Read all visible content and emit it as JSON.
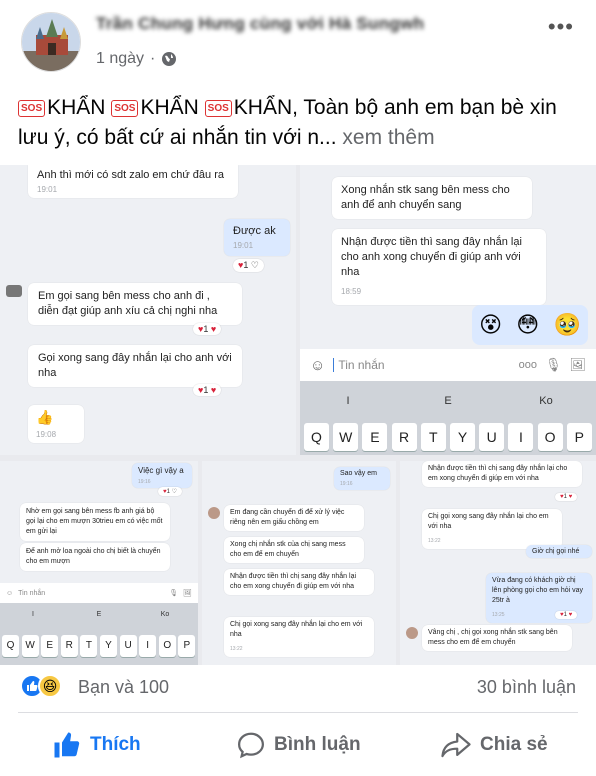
{
  "post": {
    "author": "Trần Chung Hưng cùng với Hà Sungwh",
    "time": "1 ngày",
    "sos_badge": "SOS",
    "text_main": "KHẨN  KHẨN  KHẨN, Toàn bộ anh em bạn bè xin lưu ý, có bất cứ ai nhắn tin với n...",
    "seg1": "KHẨN",
    "seg2": "KHẨN",
    "seg3": "KHẨN, Toàn bộ anh em bạn bè xin lưu ý, có bất cứ ai nhắn tin với n...",
    "see_more": "xem thêm"
  },
  "shot1": {
    "m1": "Anh thì mới có sdt zalo em chứ đâu ra",
    "m1_time": "19:01",
    "m2": "Được ak",
    "m2_time": "19:01",
    "m2_react": "1",
    "m3": "Em gọi sang bên mess cho anh đi , diễn đạt giúp anh xíu cả chị nghi nha",
    "m3_react": "1",
    "m4": "Gọi xong sang đây nhắn lại cho anh với nha",
    "m4_react": "1",
    "m5_time": "19:08"
  },
  "shot2": {
    "m1": "Xong nhắn stk sang bên mess cho anh để anh chuyển sang",
    "m2": "Nhận được tiền thì sang đây nhắn lại cho anh xong chuyển đi giúp anh với nha",
    "m2_time": "18:59",
    "input_placeholder": "Tin nhắn",
    "suggest": [
      "I",
      "E",
      "Ko"
    ],
    "keys": [
      "Q",
      "W",
      "E",
      "R",
      "T",
      "Y",
      "U",
      "I",
      "O",
      "P"
    ]
  },
  "shot3": {
    "m1": "Việc gì vậy a",
    "m1_time": "19:16",
    "m2": "Nhờ em gọi sang bên mess fb anh giá bộ gọi lại cho em mượn 30trieu em có việc mốt em gửi lại",
    "m3": "Để anh mở loa ngoài cho chị biết là chuyển cho em mượn",
    "input_placeholder": "Tin nhắn",
    "suggest": [
      "I",
      "E",
      "Ko"
    ],
    "keys": [
      "Q",
      "W",
      "E",
      "R",
      "T",
      "Y",
      "U",
      "I",
      "O",
      "P"
    ]
  },
  "shot4": {
    "m1": "Sao vậy em",
    "m1_time": "19:16",
    "m2": "Em đang cần chuyển đi để xử lý việc riêng nên em giấu chồng em",
    "m3": "Xong chị nhắn stk của chị sang mess cho em để em chuyển",
    "m4": "Nhận được tiền thì chị sang đây nhắn lại cho em xong chuyển đi giúp em với nha",
    "m5": "Chị gọi xong sang đây nhắn lại cho em với nha",
    "m5_time": "13:22"
  },
  "shot5": {
    "m1": "Nhận được tiền thì chị sang đây nhắn lại cho em xong chuyển đi giúp em với nha",
    "m2": "Chị gọi xong sang đây nhắn lại cho em với nha",
    "m2_time": "13:22",
    "m3": "Giờ chị gọi nhé",
    "m4": "Vừa đang có khách giờ chị lên phòng gọi cho em hỏi vay 25tr à",
    "m4_time": "13:25",
    "m5": "Vâng chị , chị gọi xong nhắn stk sang bên mess cho em để em chuyển"
  },
  "stats": {
    "reactions_text": "Bạn và 100",
    "comments_text": "30 bình luận"
  },
  "actions": {
    "like": "Thích",
    "comment": "Bình luận",
    "share": "Chia sẻ"
  },
  "colors": {
    "like_blue": "#1877f2",
    "meta_gray": "#65676b",
    "heart_red": "#d8223a"
  }
}
